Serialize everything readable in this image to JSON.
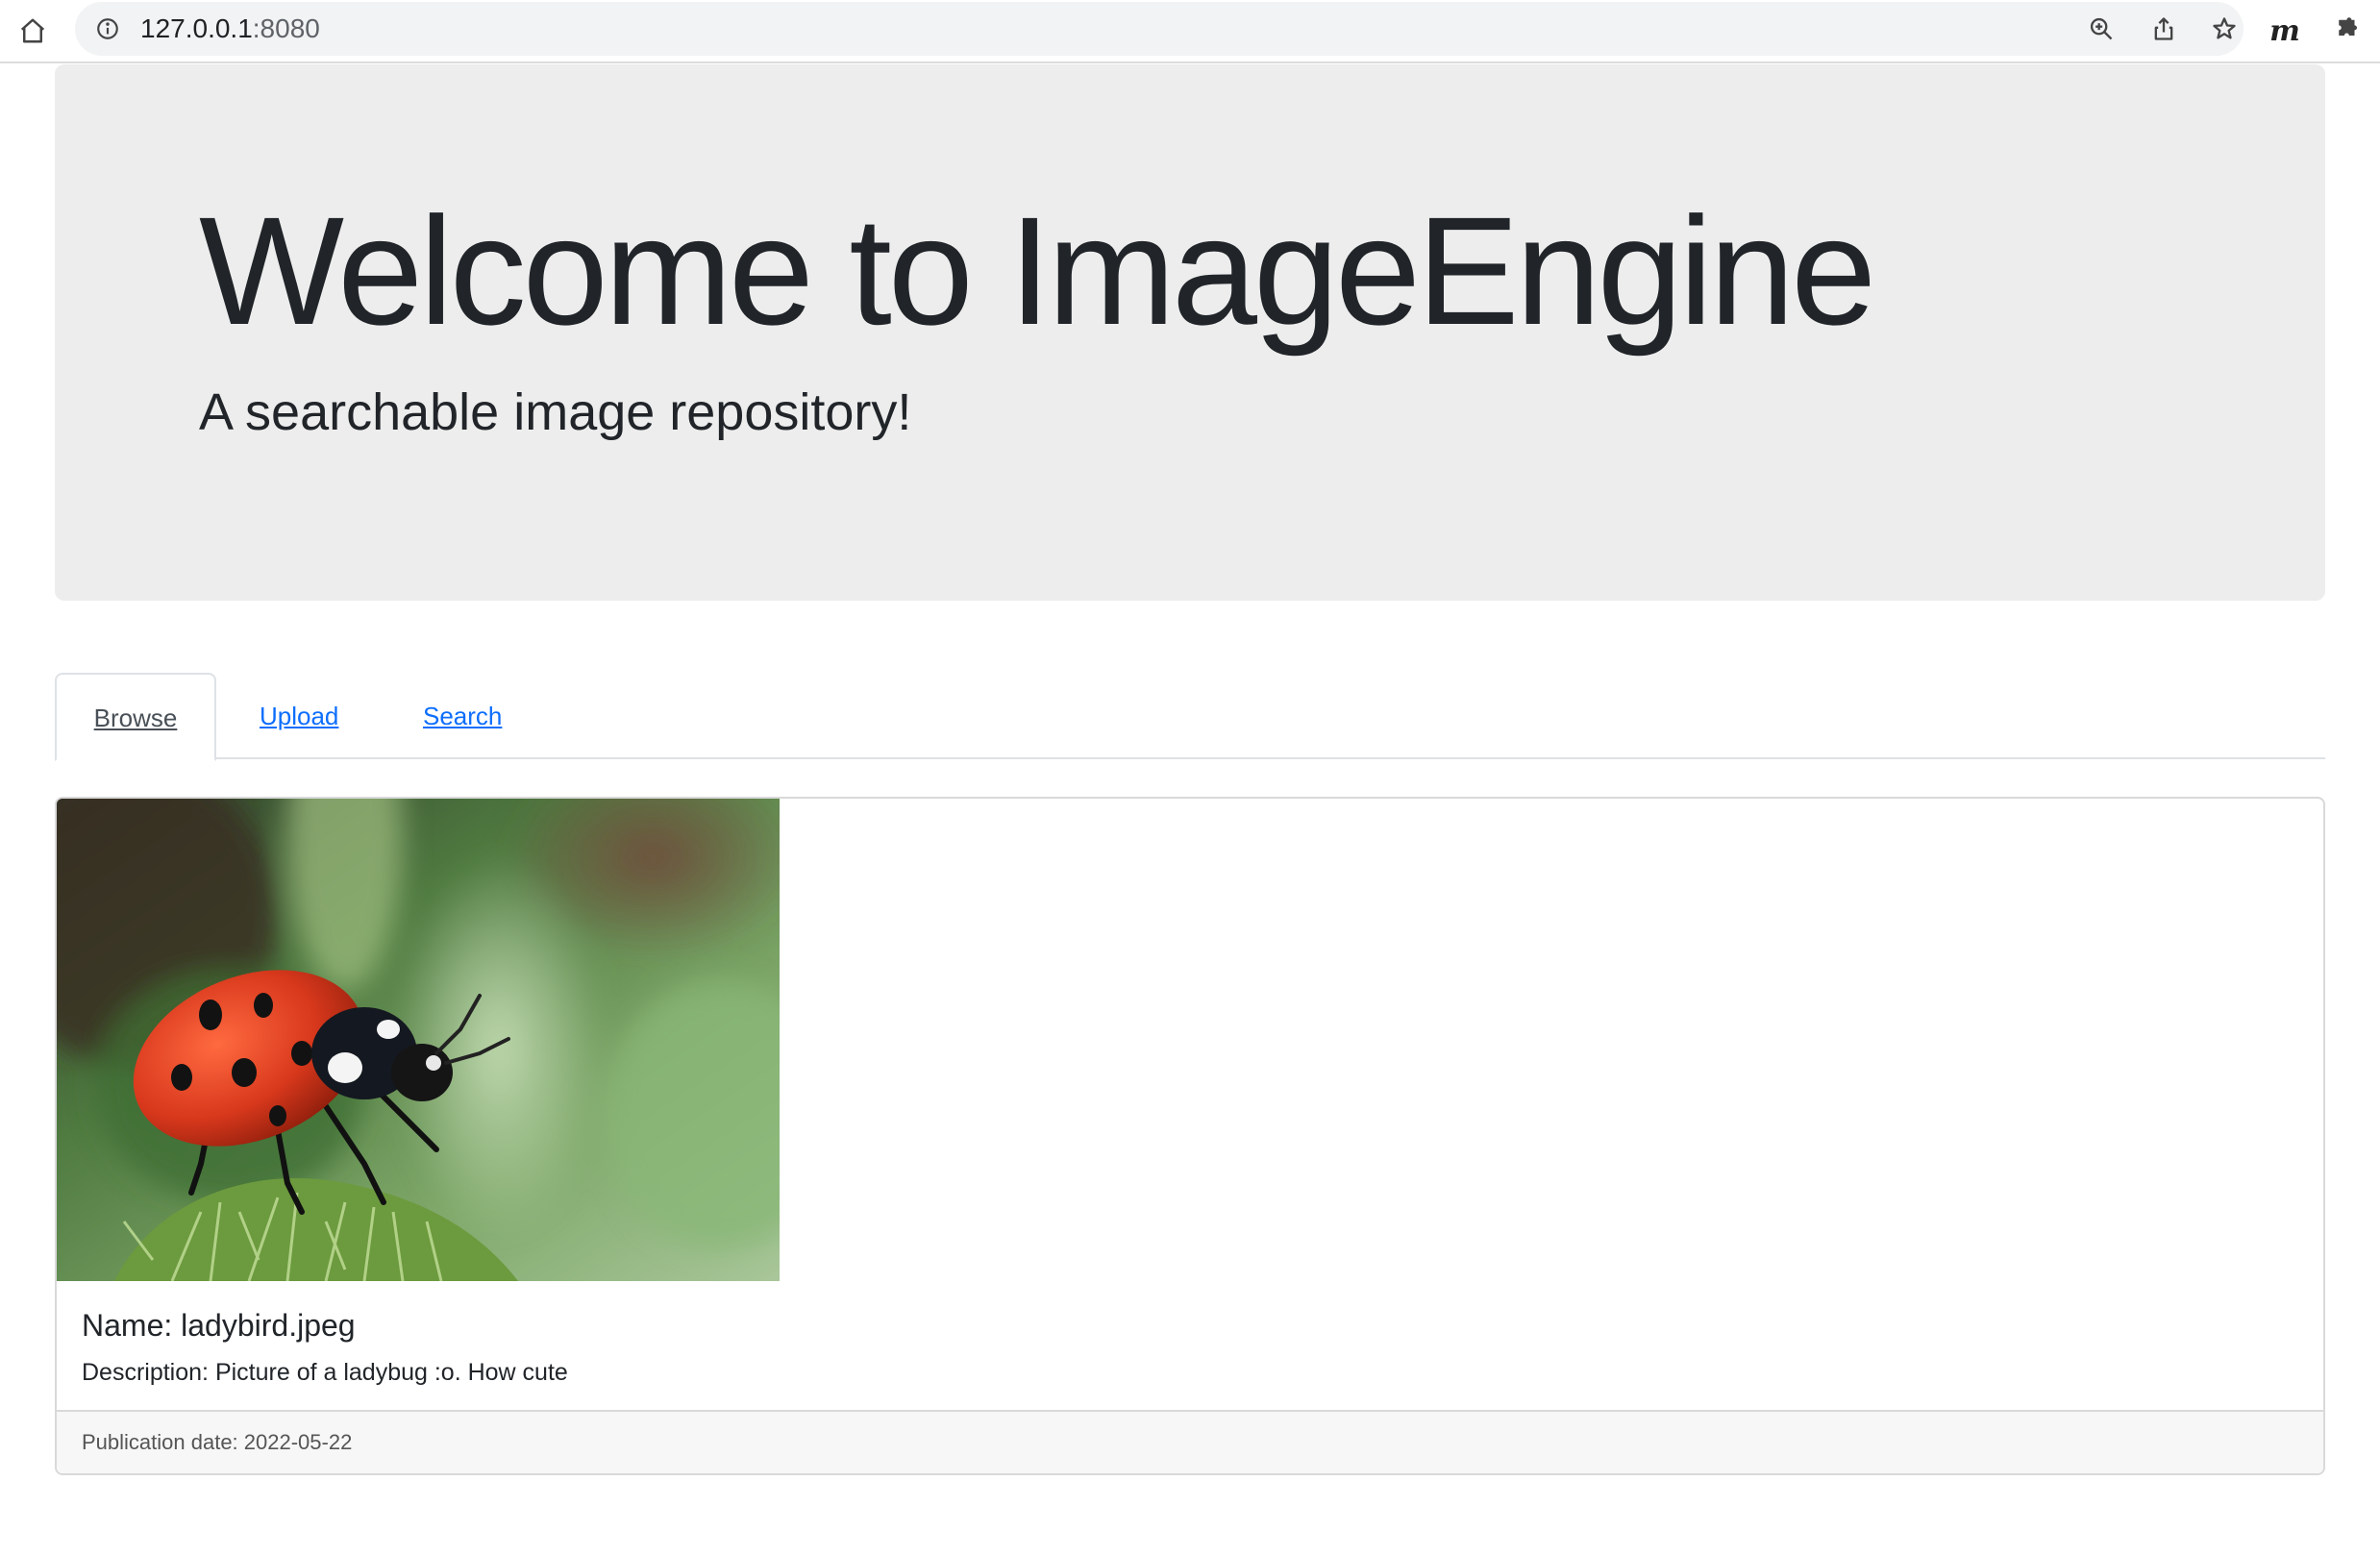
{
  "browser": {
    "url_host": "127.0.0.1",
    "url_port": ":8080"
  },
  "hero": {
    "title": "Welcome to ImageEngine",
    "subtitle": "A searchable image repository!"
  },
  "tabs": [
    {
      "label": "Browse",
      "active": true
    },
    {
      "label": "Upload",
      "active": false
    },
    {
      "label": "Search",
      "active": false
    }
  ],
  "card": {
    "name": "Name: ladybird.jpeg",
    "description": "Description: Picture of a ladybug :o. How cute",
    "publication": "Publication date: 2022-05-22",
    "image_subject": "ladybird"
  },
  "colors": {
    "jumbotron_bg": "#ededed",
    "link": "#0d6efd",
    "text": "#212529"
  }
}
